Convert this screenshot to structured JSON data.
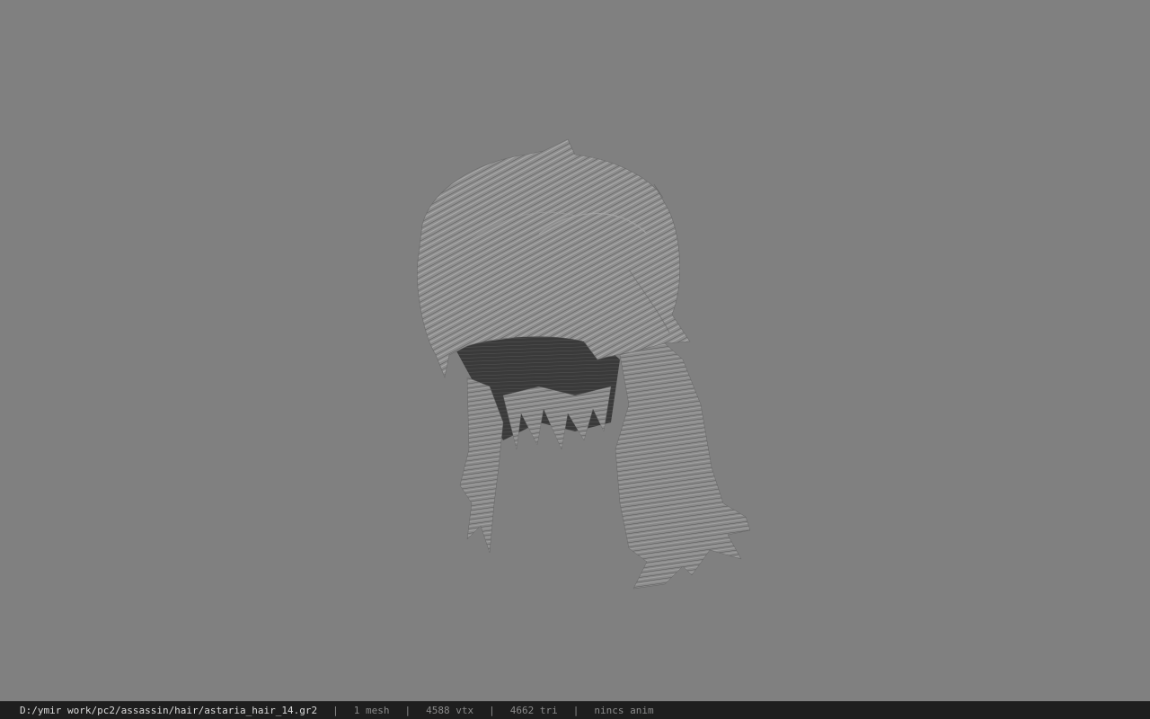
{
  "viewport": {
    "background_color": "#808080",
    "model": "hair-mesh"
  },
  "status_bar": {
    "file_path": "D:/ymir work/pc2/assassin/hair/astaria_hair_14.gr2",
    "separator": "|",
    "mesh_count": "1 mesh",
    "vertex_count": "4588 vtx",
    "triangle_count": "4662 tri",
    "animation": "nincs anim"
  }
}
